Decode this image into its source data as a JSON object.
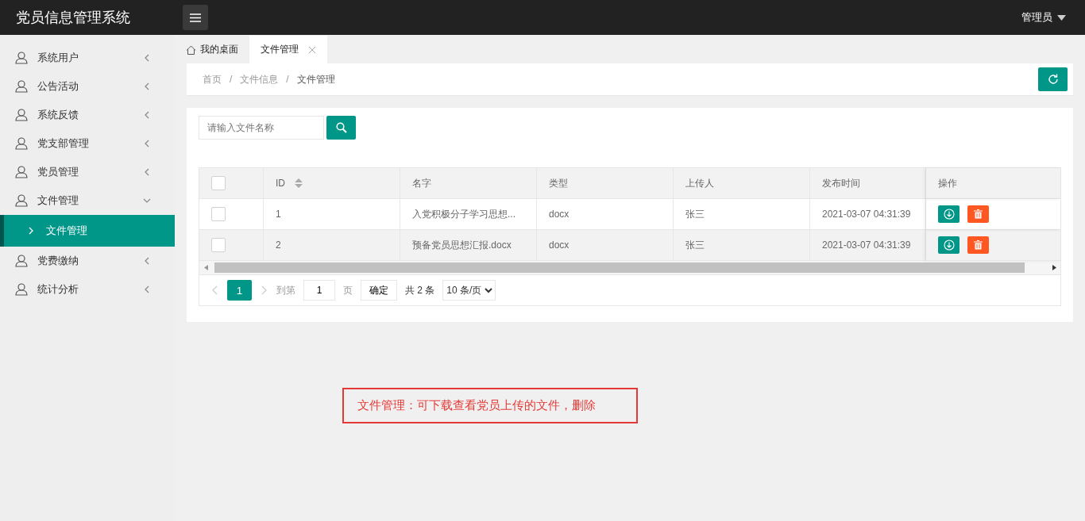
{
  "header": {
    "title": "党员信息管理系统",
    "user": "管理员"
  },
  "sidebar": {
    "items": [
      {
        "label": "系统用户",
        "expanded": false
      },
      {
        "label": "公告活动",
        "expanded": false
      },
      {
        "label": "系统反馈",
        "expanded": false
      },
      {
        "label": "党支部管理",
        "expanded": false
      },
      {
        "label": "党员管理",
        "expanded": false
      },
      {
        "label": "文件管理",
        "expanded": true,
        "children": [
          {
            "label": "文件管理",
            "selected": true
          }
        ]
      },
      {
        "label": "党费缴纳",
        "expanded": false
      },
      {
        "label": "统计分析",
        "expanded": false
      }
    ]
  },
  "tabs": [
    {
      "label": "我的桌面",
      "kind": "home",
      "selected": false
    },
    {
      "label": "文件管理",
      "kind": "closable",
      "selected": true
    }
  ],
  "breadcrumb": {
    "separator": "/",
    "items": [
      "首页",
      "文件信息",
      "文件管理"
    ]
  },
  "search": {
    "placeholder": "请输入文件名称"
  },
  "table": {
    "select_all": {
      "checked": false
    },
    "columns": [
      "ID",
      "名字",
      "类型",
      "上传人",
      "发布时间",
      "操作"
    ],
    "rows": [
      {
        "checked": false,
        "hovered": false,
        "cells": [
          "1",
          "入党积极分子学习思想...",
          "docx",
          "张三",
          "2021-03-07 04:31:39"
        ]
      },
      {
        "checked": false,
        "hovered": true,
        "cells": [
          "2",
          "预备党员思想汇报.docx",
          "docx",
          "张三",
          "2021-03-07 04:31:39"
        ]
      }
    ]
  },
  "pagination": {
    "pages": [
      {
        "label": "1",
        "selected": true
      }
    ],
    "goto_label": "到第",
    "goto_value": "1",
    "page_label": "页",
    "confirm": "确定",
    "total": "共 2 条",
    "page_size": "10 条/页"
  },
  "annotation": "文件管理：可下载查看党员上传的文件，删除"
}
